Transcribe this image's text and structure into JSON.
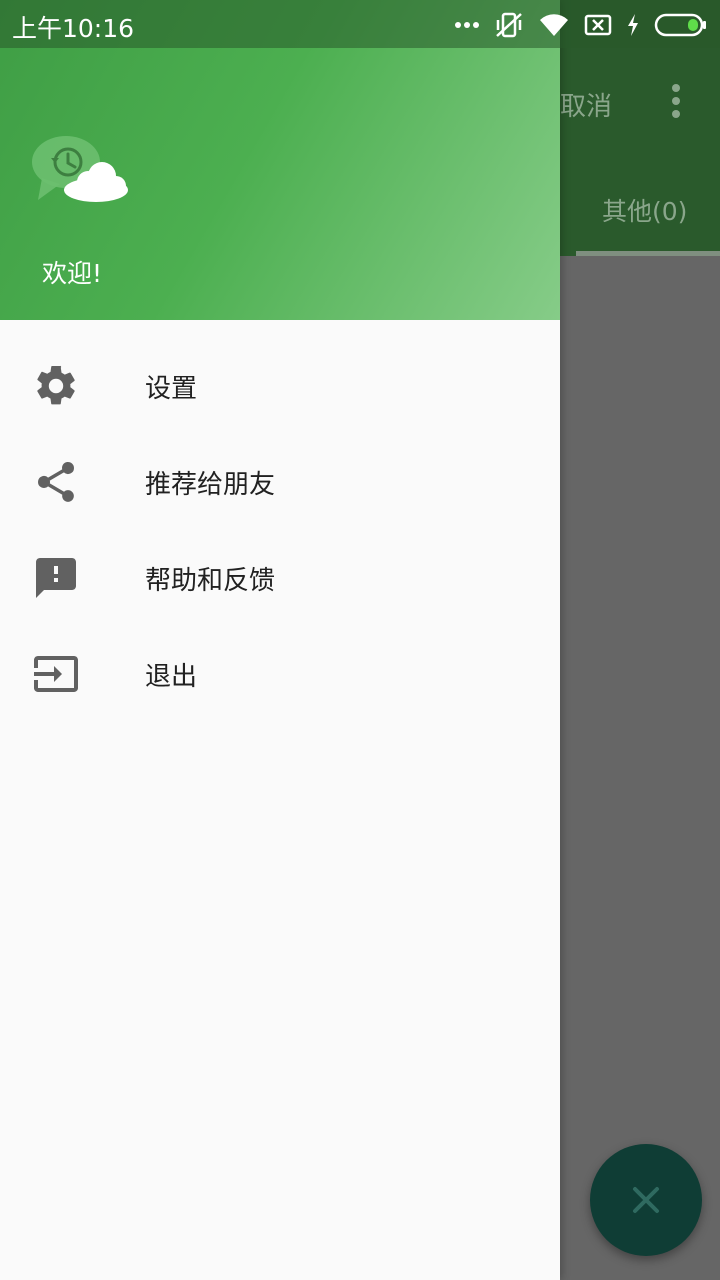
{
  "status_bar": {
    "time": "上午10:16"
  },
  "background_app": {
    "cancel_label": "取消",
    "tab_label": "其他(0)"
  },
  "drawer": {
    "welcome": "欢迎!",
    "menu": [
      {
        "label": "设置",
        "icon": "gear-icon"
      },
      {
        "label": "推荐给朋友",
        "icon": "share-icon"
      },
      {
        "label": "帮助和反馈",
        "icon": "feedback-icon"
      },
      {
        "label": "退出",
        "icon": "exit-icon"
      }
    ]
  },
  "colors": {
    "header_green": "#4caf50",
    "icon_gray": "#616161",
    "fab": "#0f3d35"
  }
}
